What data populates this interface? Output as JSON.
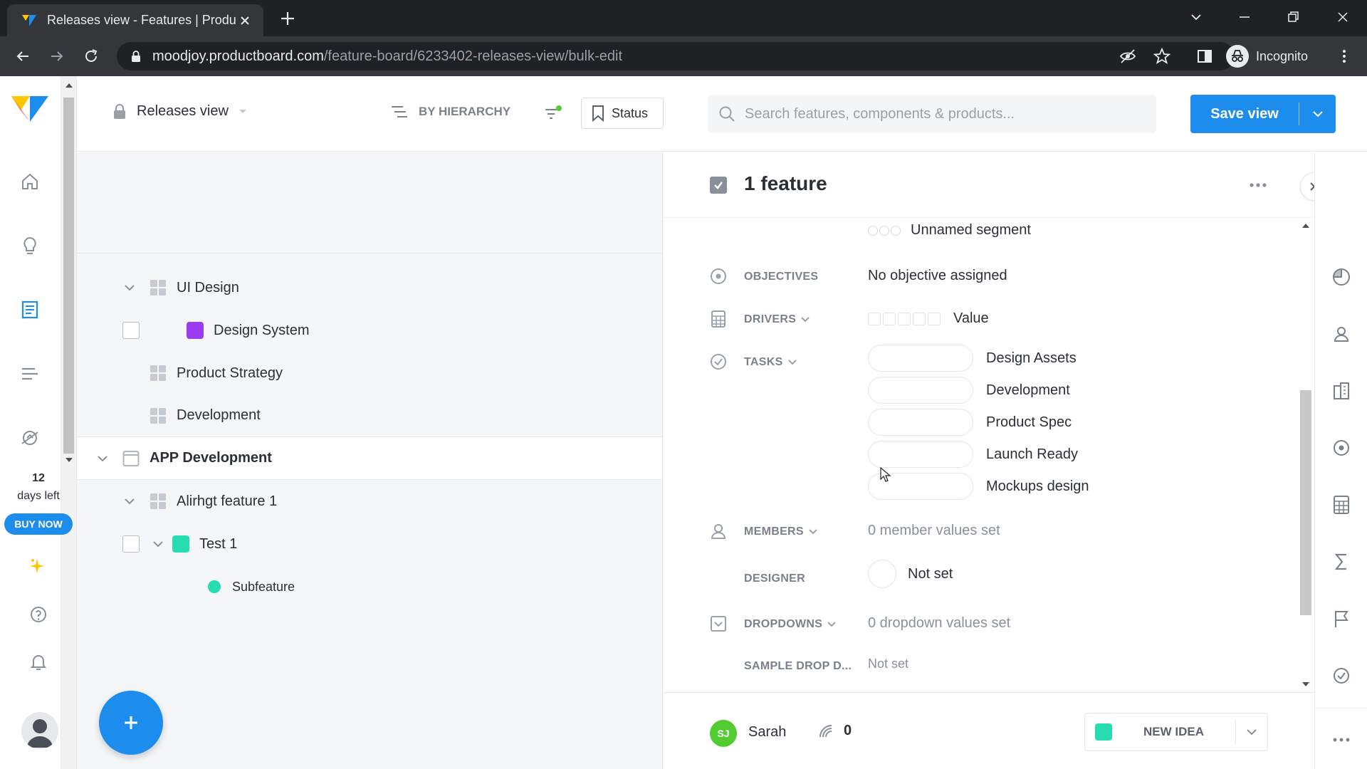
{
  "browser": {
    "tab_title": "Releases view - Features | Produc",
    "url_host": "moodjoy.productboard.com",
    "url_path": "/feature-board/6233402-releases-view/bulk-edit",
    "profile_label": "Incognito"
  },
  "sidebar": {
    "trial_days": "12",
    "trial_label": "days left",
    "buy_label": "BUY NOW"
  },
  "header": {
    "view_name": "Releases view",
    "grouping": "BY HIERARCHY",
    "status_label": "Status",
    "search_placeholder": "Search features, components & products...",
    "save_label": "Save view"
  },
  "board": {
    "rows": [
      {
        "label": "UI Design"
      },
      {
        "label": "Design System",
        "color": "#9b3cf0"
      },
      {
        "label": "Product Strategy"
      },
      {
        "label": "Development"
      },
      {
        "label": "APP Development"
      },
      {
        "label": "Alirhgt feature 1"
      },
      {
        "label": "Test 1",
        "color": "#27dcb0"
      },
      {
        "label": "Subfeature",
        "color": "#27dcb0"
      }
    ]
  },
  "detail": {
    "title": "1 feature",
    "segment_value": "Unnamed segment",
    "fields": {
      "objectives": {
        "label": "OBJECTIVES",
        "value": "No objective assigned"
      },
      "drivers": {
        "label": "DRIVERS",
        "value": "Value"
      },
      "tasks": {
        "label": "TASKS",
        "items": [
          "Design Assets",
          "Development",
          "Product Spec",
          "Launch Ready",
          "Mockups design"
        ]
      },
      "members": {
        "label": "MEMBERS",
        "value": "0 member values set"
      },
      "designer": {
        "label": "DESIGNER",
        "value": "Not set"
      },
      "dropdowns": {
        "label": "DROPDOWNS",
        "value": "0 dropdown values set"
      },
      "sample_drop": {
        "label": "SAMPLE DROP D...",
        "value": "Not set"
      }
    },
    "footer": {
      "owner_initials": "SJ",
      "owner_name": "Sarah",
      "votes": "0",
      "status": "NEW IDEA"
    }
  },
  "colors": {
    "accent": "#1c8ded",
    "owner_avatar": "#52cc30",
    "status_new_idea": "#27dcb0"
  }
}
